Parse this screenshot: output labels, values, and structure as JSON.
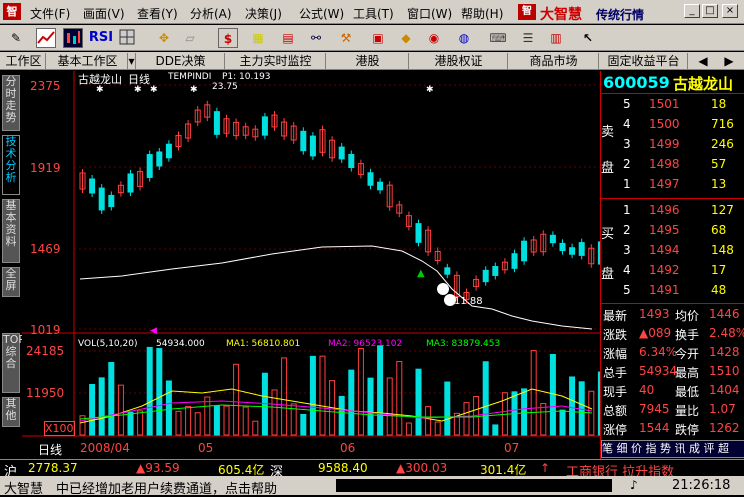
{
  "menu": {
    "items": [
      "文件(F)",
      "画面(V)",
      "查看(Y)",
      "分析(A)",
      "决策(J)",
      "公式(W)",
      "工具(T)",
      "窗口(W)",
      "帮助(H)"
    ]
  },
  "brand": {
    "name": "大智慧",
    "tagline": "传统行情"
  },
  "toolbar": {
    "rsi": "RSI",
    "dollar": "$"
  },
  "tabs": [
    "工作区",
    "基本工作区",
    "DDE决策",
    "主力实时监控",
    "港股",
    "港股权证",
    "商品市场",
    "固定收益平台"
  ],
  "left_tabs": [
    "分时走势",
    "技术分析",
    "基本资料",
    "全屏",
    "TOP综合",
    "其他"
  ],
  "chart": {
    "title": "古越龙山",
    "period": "日线",
    "indicator": "TEMPINDI",
    "p1_label": "P1: 10.193",
    "high_label": "23.75",
    "low_label": "11.88",
    "price_ticks": [
      "2375",
      "1919",
      "1469",
      "1019"
    ],
    "vol_ticks": [
      "24185",
      "11950",
      "X100"
    ],
    "vol_header": {
      "label": "VOL(5,10,20)",
      "vol": "54934.000",
      "ma1": "MA1: 56810.801",
      "ma2": "MA2: 96523.102",
      "ma3": "MA3: 83879.453"
    },
    "date_bar": {
      "period": "日线",
      "dates": [
        "2008/04",
        "05",
        "06",
        "07"
      ]
    }
  },
  "chart_data": {
    "type": "candlestick",
    "title": "古越龙山 日线",
    "ylim": [
      1019,
      2375
    ],
    "note": "daily candles Apr–Jul 2008 with volume panel"
  },
  "quote": {
    "code": "600059",
    "name": "古越龙山",
    "sell_label": "卖",
    "buy_label": "买",
    "panel_label": "盘",
    "asks": [
      {
        "n": "5",
        "p": "1501",
        "v": "18"
      },
      {
        "n": "4",
        "p": "1500",
        "v": "716"
      },
      {
        "n": "3",
        "p": "1499",
        "v": "246"
      },
      {
        "n": "2",
        "p": "1498",
        "v": "57"
      },
      {
        "n": "1",
        "p": "1497",
        "v": "13"
      }
    ],
    "bids": [
      {
        "n": "1",
        "p": "1496",
        "v": "127"
      },
      {
        "n": "2",
        "p": "1495",
        "v": "68"
      },
      {
        "n": "3",
        "p": "1494",
        "v": "148"
      },
      {
        "n": "4",
        "p": "1492",
        "v": "17"
      },
      {
        "n": "5",
        "p": "1491",
        "v": "48"
      }
    ],
    "stats": [
      {
        "l": "最新",
        "v": "1493",
        "l2": "均价",
        "v2": "1446"
      },
      {
        "l": "涨跌",
        "v": "▲089",
        "l2": "换手",
        "v2": "2.48%"
      },
      {
        "l": "涨幅",
        "v": "6.34%",
        "l2": "今开",
        "v2": "1428"
      },
      {
        "l": "总手",
        "v": "54934",
        "l2": "最高",
        "v2": "1510"
      },
      {
        "l": "现手",
        "v": "40",
        "l2": "最低",
        "v2": "1404"
      },
      {
        "l": "总额",
        "v": "7945",
        "l2": "量比",
        "v2": "1.07"
      },
      {
        "l": "涨停",
        "v": "1544",
        "l2": "跌停",
        "v2": "1262"
      }
    ],
    "bottom_tabs": "笔 细 价 指 势 讯 成 评 超"
  },
  "status": {
    "sh_label": "沪",
    "sh_idx": "2778.37",
    "sh_chg": "▲93.59",
    "sh_amt": "605.4亿",
    "sz_label": "深",
    "sz_idx": "9588.40",
    "sz_chg": "▲300.03",
    "sz_amt": "301.4亿",
    "ticker": "工商银行 拉升指数",
    "msg_brand": "大智慧",
    "msg": "中已经增加老用户续费通道，点击帮助",
    "time": "21:26:18"
  }
}
